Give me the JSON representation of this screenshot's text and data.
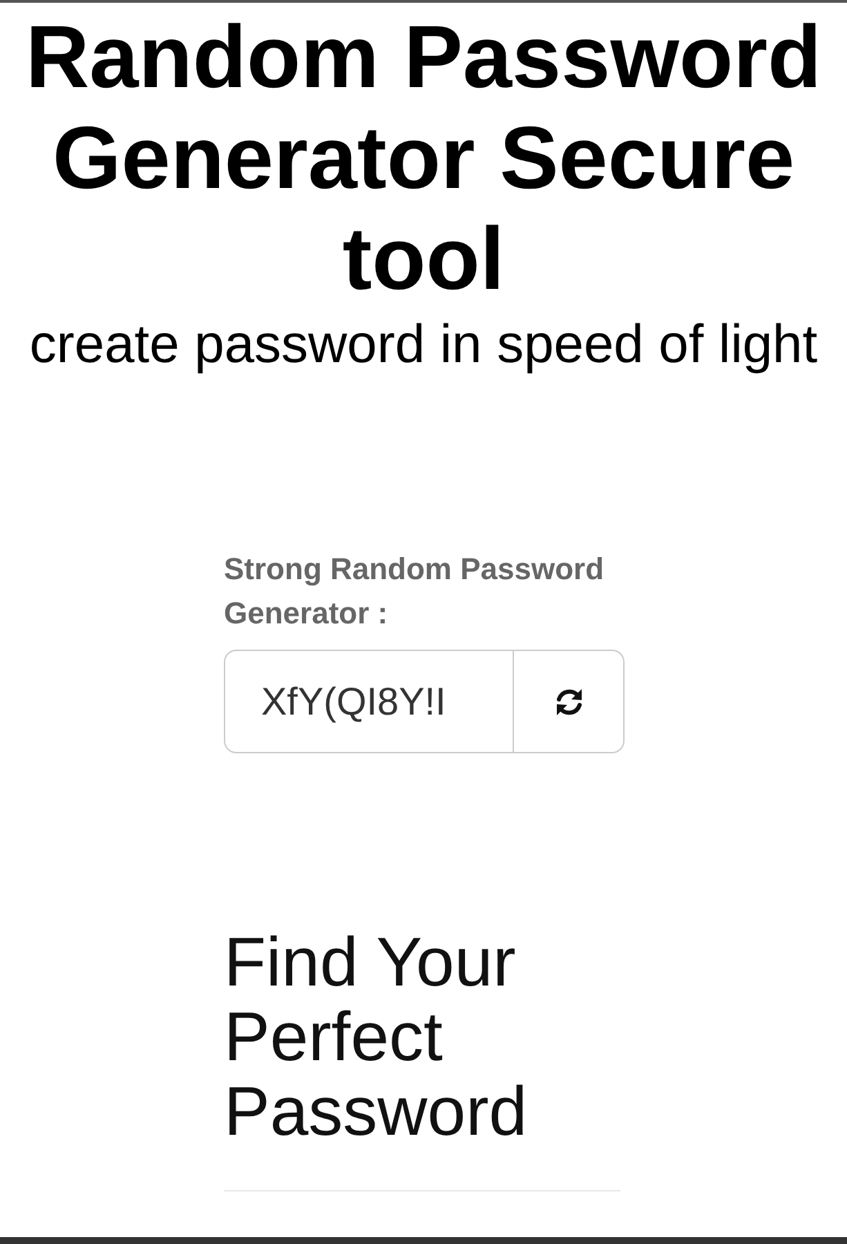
{
  "title": "Random Password Generator Secure tool",
  "subtitle": "create password in speed of light",
  "generator": {
    "label": "Strong Random Password Generator :",
    "password": "XfY(QI8Y!I"
  },
  "section": {
    "heading": "Find Your Perfect Password"
  }
}
